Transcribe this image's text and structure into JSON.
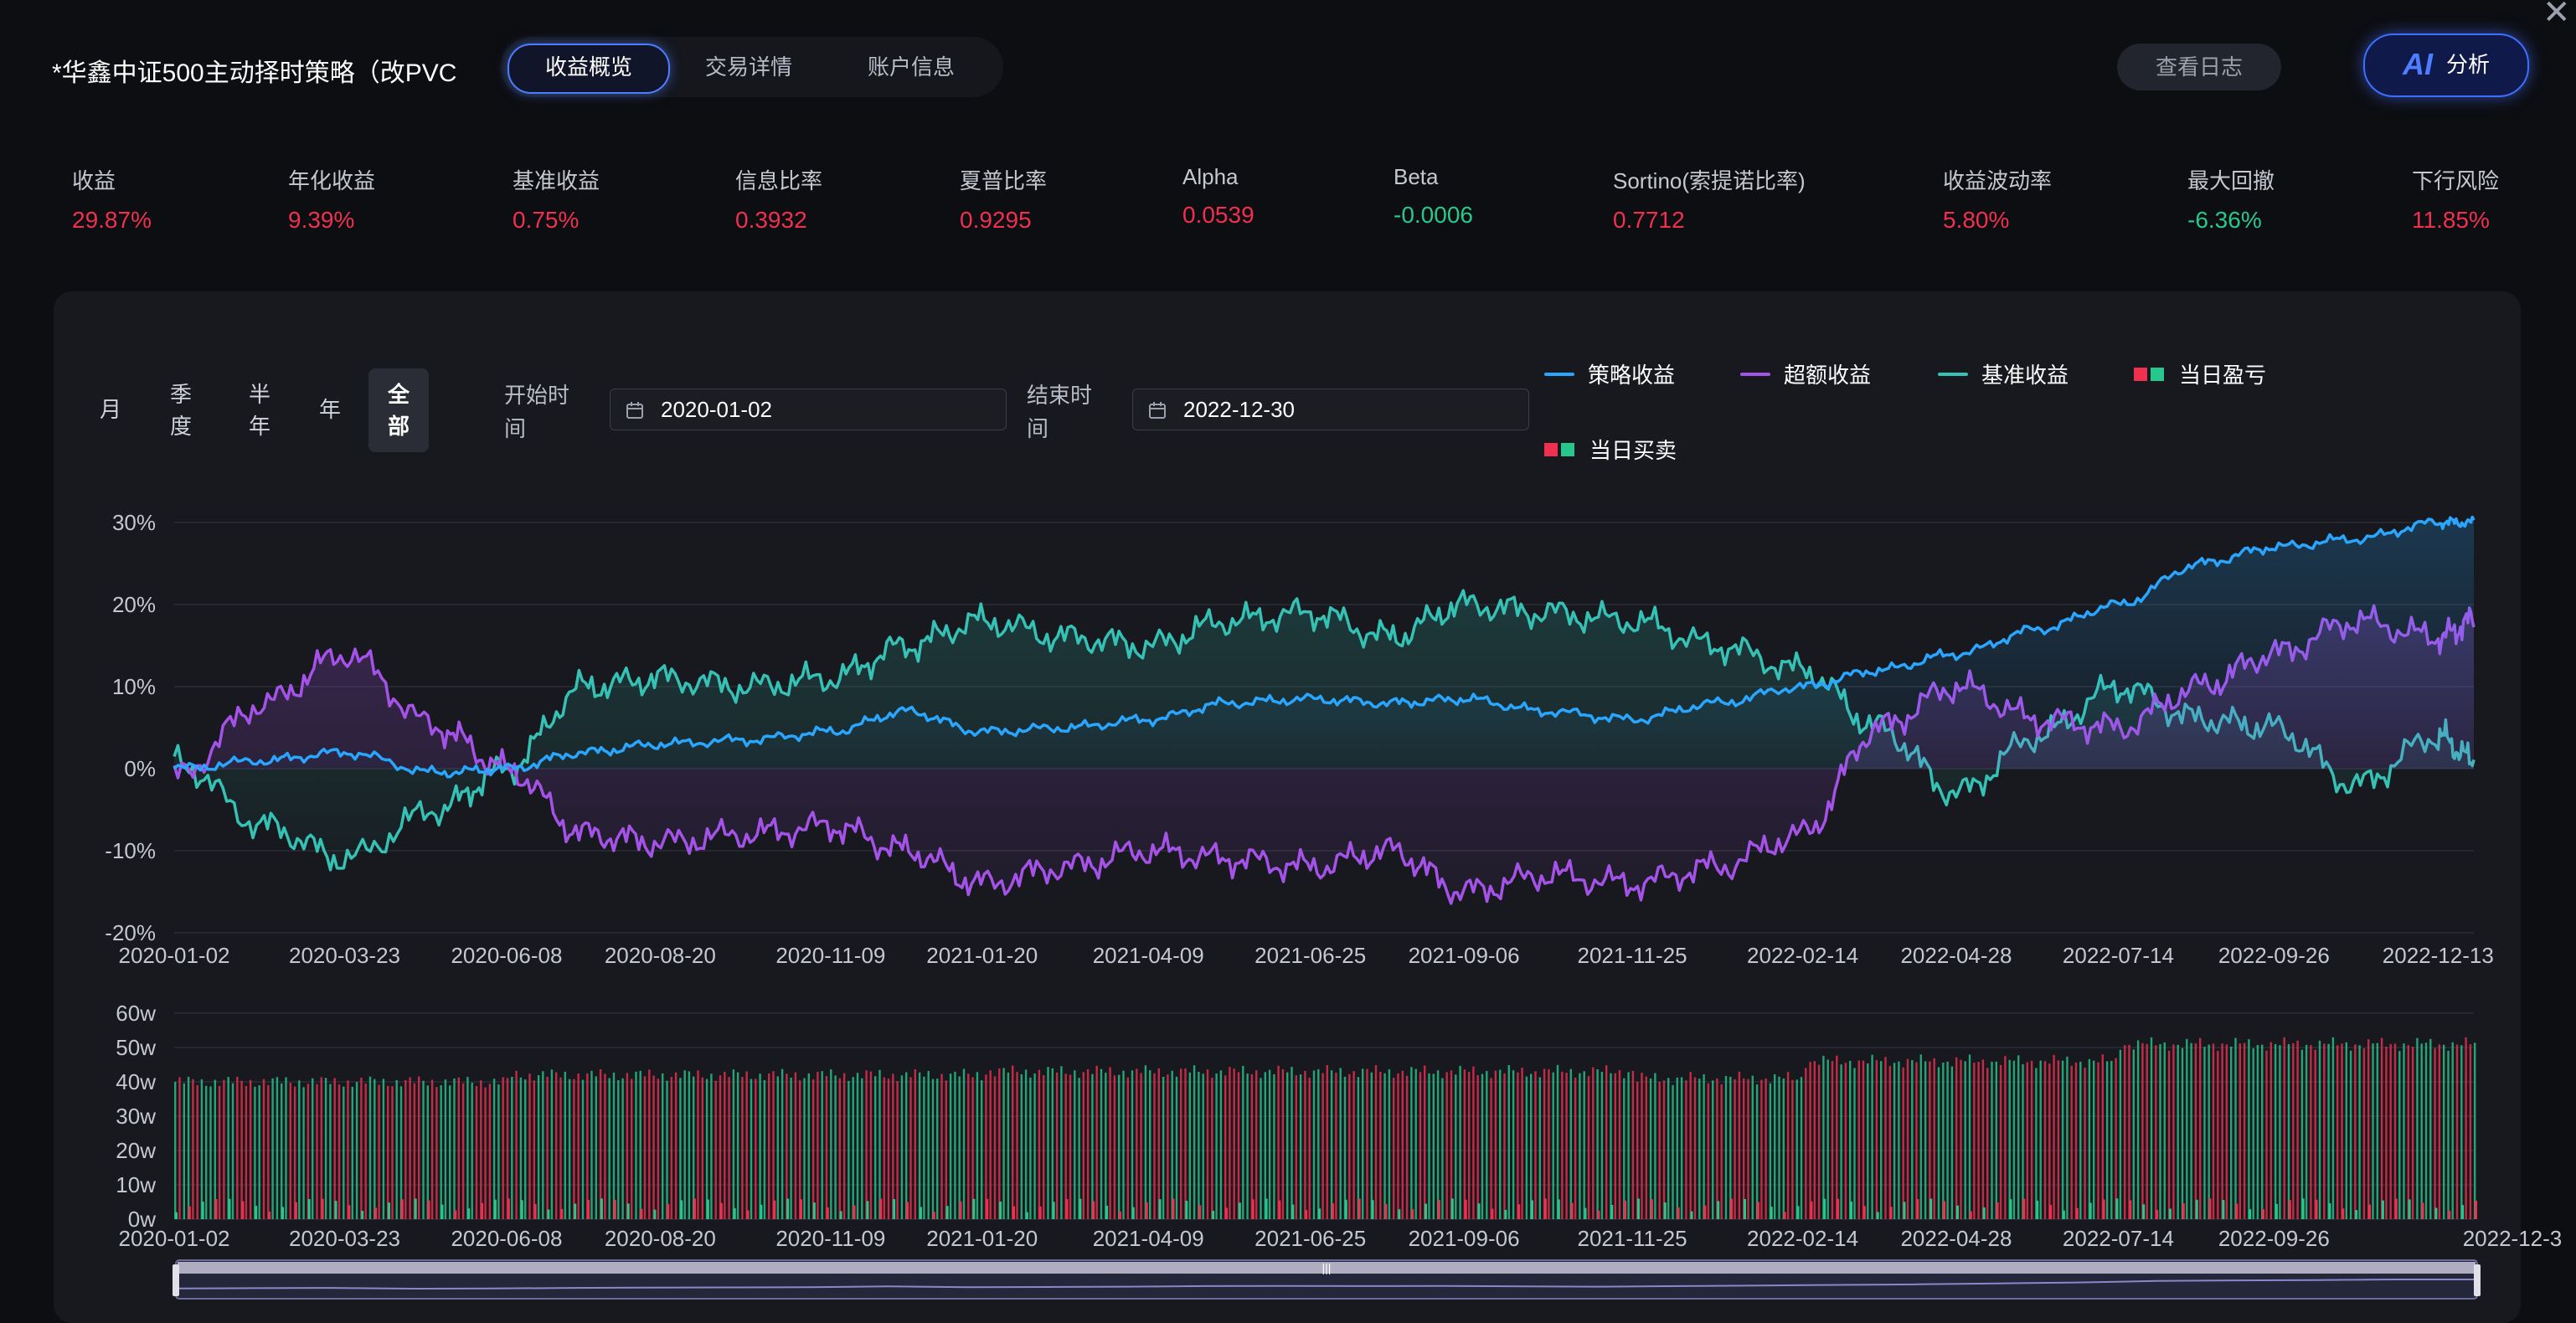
{
  "header": {
    "title": "*华鑫中证500主动择时策略（改PVC",
    "tabs": [
      {
        "label": "收益概览",
        "active": true
      },
      {
        "label": "交易详情",
        "active": false
      },
      {
        "label": "账户信息",
        "active": false
      }
    ],
    "log_button": "查看日志",
    "ai_button": {
      "icon": "AI",
      "label": "分析"
    },
    "close_icon": "close-icon"
  },
  "metrics": [
    {
      "label": "收益",
      "value": "29.87%",
      "tone": "up"
    },
    {
      "label": "年化收益",
      "value": "9.39%",
      "tone": "up"
    },
    {
      "label": "基准收益",
      "value": "0.75%",
      "tone": "up"
    },
    {
      "label": "信息比率",
      "value": "0.3932",
      "tone": "up"
    },
    {
      "label": "夏普比率",
      "value": "0.9295",
      "tone": "up"
    },
    {
      "label": "Alpha",
      "value": "0.0539",
      "tone": "up"
    },
    {
      "label": "Beta",
      "value": "-0.0006",
      "tone": "down"
    },
    {
      "label": "Sortino(索提诺比率)",
      "value": "0.7712",
      "tone": "up"
    },
    {
      "label": "收益波动率",
      "value": "5.80%",
      "tone": "up"
    },
    {
      "label": "最大回撤",
      "value": "-6.36%",
      "tone": "down"
    },
    {
      "label": "下行风险",
      "value": "11.85%",
      "tone": "up"
    }
  ],
  "colors": {
    "up": "#f0304f",
    "down": "#28c88c",
    "strategy": "#2aa6ff",
    "excess": "#a552e8",
    "benchmark": "#36c1b5",
    "accent": "#3f6dff"
  },
  "filters": {
    "periods": [
      {
        "label": "月",
        "active": false
      },
      {
        "label": "季度",
        "active": false
      },
      {
        "label": "半年",
        "active": false
      },
      {
        "label": "年",
        "active": false
      },
      {
        "label": "全部",
        "active": true
      }
    ],
    "start_label": "开始时间",
    "start_value": "2020-01-02",
    "end_label": "结束时间",
    "end_value": "2022-12-30",
    "calendar_icon": "calendar-icon"
  },
  "legend": [
    {
      "name": "策略收益",
      "kind": "line",
      "color": "#2aa6ff"
    },
    {
      "name": "超额收益",
      "kind": "line",
      "color": "#a552e8"
    },
    {
      "name": "基准收益",
      "kind": "line",
      "color": "#36c1b5"
    },
    {
      "name": "当日盈亏",
      "kind": "squares",
      "colors": [
        "#f0304f",
        "#28c88c"
      ]
    },
    {
      "name": "当日买卖",
      "kind": "squares",
      "colors": [
        "#f0304f",
        "#28c88c"
      ]
    }
  ],
  "chart_data": [
    {
      "type": "line",
      "x": [
        "2020-01-02",
        "2020-02-14",
        "2020-03-23",
        "2020-05-06",
        "2020-06-08",
        "2020-07-15",
        "2020-08-20",
        "2020-09-30",
        "2020-11-09",
        "2020-12-15",
        "2021-01-20",
        "2021-03-01",
        "2021-04-09",
        "2021-05-17",
        "2021-06-25",
        "2021-08-02",
        "2021-09-06",
        "2021-10-15",
        "2021-11-25",
        "2022-01-04",
        "2022-02-14",
        "2022-03-22",
        "2022-04-28",
        "2022-06-06",
        "2022-07-14",
        "2022-08-22",
        "2022-09-26",
        "2022-11-04",
        "2022-12-13",
        "2022-12-30"
      ],
      "series": [
        {
          "name": "策略收益",
          "values": [
            0,
            1,
            2,
            -0.5,
            0,
            2,
            3,
            3.5,
            4.5,
            7,
            4.5,
            5,
            6,
            8,
            8.5,
            8,
            8.5,
            7,
            6,
            8,
            10,
            12,
            14,
            17,
            20,
            25,
            27,
            28,
            30,
            30
          ]
        },
        {
          "name": "超额收益",
          "values": [
            -1,
            8,
            14,
            5,
            0,
            -8,
            -9,
            -8,
            -7,
            -10,
            -14,
            -12,
            -10,
            -11,
            -12,
            -10,
            -15,
            -13,
            -14,
            -12,
            -8,
            5,
            10,
            6,
            5,
            10,
            14,
            18,
            16,
            18
          ]
        },
        {
          "name": "基准收益",
          "values": [
            1,
            -7,
            -11,
            -5,
            0,
            10,
            11,
            10,
            11,
            15,
            18,
            16,
            15,
            18,
            19,
            16,
            20,
            19,
            18,
            15,
            12,
            5,
            -3,
            4,
            10,
            6,
            5,
            -2,
            4,
            1
          ]
        }
      ],
      "ylim": [
        -20,
        30
      ],
      "yticks": [
        "30%",
        "20%",
        "10%",
        "0%",
        "-10%",
        "-20%"
      ],
      "xticks": [
        "2020-01-02",
        "2020-03-23",
        "2020-06-08",
        "2020-08-20",
        "2020-11-09",
        "2021-01-20",
        "2021-04-09",
        "2021-06-25",
        "2021-09-06",
        "2021-11-25",
        "2022-02-14",
        "2022-04-28",
        "2022-07-14",
        "2022-09-26",
        "2022-12-13"
      ],
      "grid": true,
      "legend_position": "top-right"
    },
    {
      "type": "bar",
      "name": "当日买卖",
      "x_range": [
        "2020-01-02",
        "2022-12-30"
      ],
      "level_by_period": [
        {
          "from": "2020-01-02",
          "to": "2020-06-08",
          "value_w": 40
        },
        {
          "from": "2020-06-08",
          "to": "2021-01-20",
          "value_w": 42
        },
        {
          "from": "2021-01-20",
          "to": "2021-11-25",
          "value_w": 43
        },
        {
          "from": "2021-11-25",
          "to": "2022-02-14",
          "value_w": 41
        },
        {
          "from": "2022-02-14",
          "to": "2022-07-14",
          "value_w": 46
        },
        {
          "from": "2022-07-14",
          "to": "2022-12-30",
          "value_w": 51
        }
      ],
      "ylim": [
        0,
        60
      ],
      "yticks": [
        "60w",
        "50w",
        "40w",
        "30w",
        "20w",
        "10w",
        "0w"
      ],
      "xticks": [
        "2020-01-02",
        "2020-03-23",
        "2020-06-08",
        "2020-08-20",
        "2020-11-09",
        "2021-01-20",
        "2021-04-09",
        "2021-06-25",
        "2021-09-06",
        "2021-11-25",
        "2022-02-14",
        "2022-04-28",
        "2022-07-14",
        "2022-09-26",
        "2022-12-3"
      ],
      "colors": [
        "#f0304f",
        "#28c88c"
      ],
      "grid": true
    }
  ]
}
